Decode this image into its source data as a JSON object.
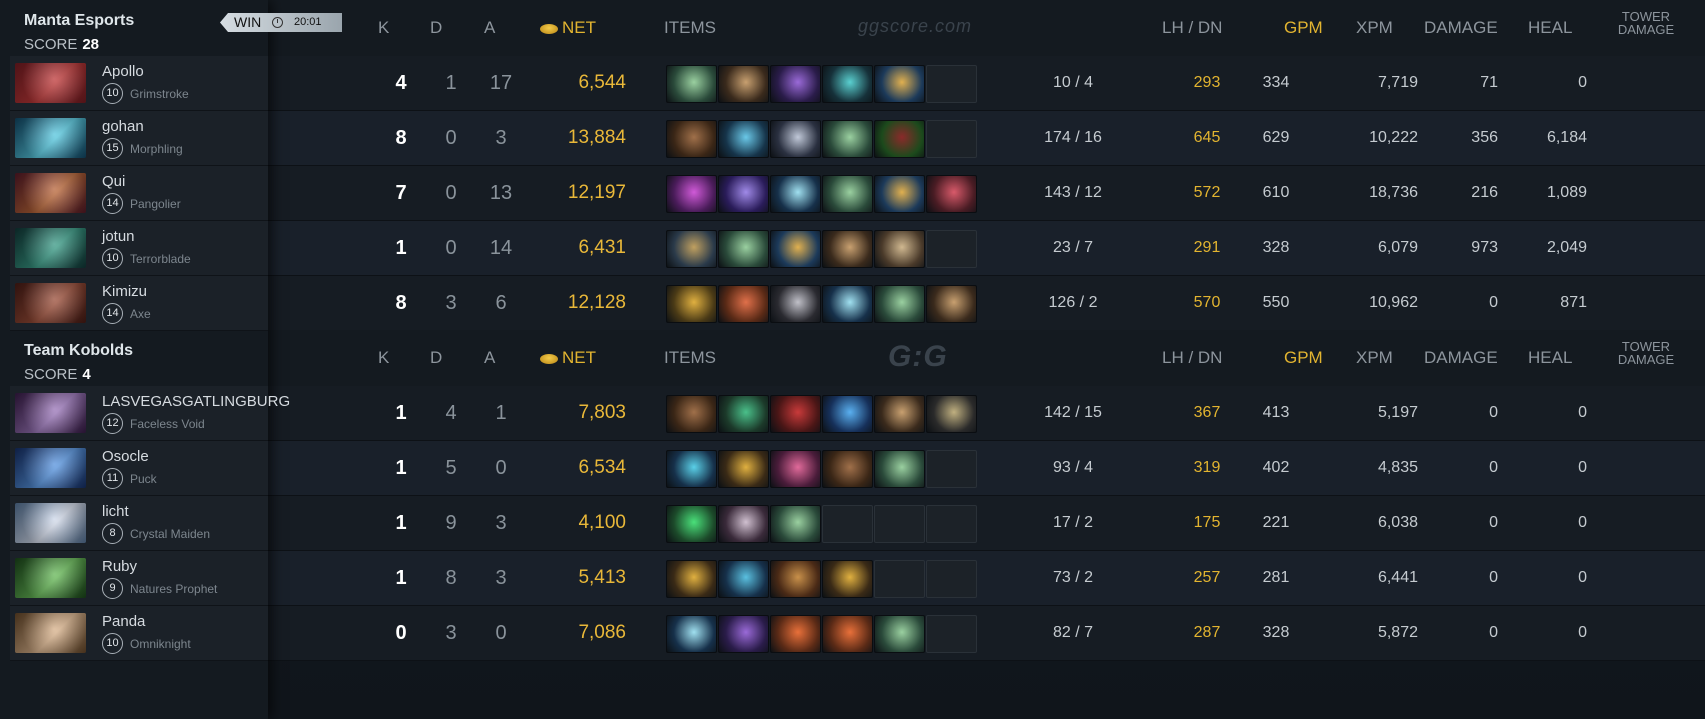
{
  "headers": {
    "k": "K",
    "d": "D",
    "a": "A",
    "net": "NET",
    "items": "ITEMS",
    "lhdn": "LH  /  DN",
    "gpm": "GPM",
    "xpm": "XPM",
    "damage": "DAMAGE",
    "heal": "HEAL",
    "tower_line1": "TOWER",
    "tower_line2": "DAMAGE"
  },
  "watermark_top": "ggscore.com",
  "watermark_mid": "G:G",
  "teams": [
    {
      "name": "Manta Esports",
      "score_label": "SCORE",
      "score": "28",
      "result": "WIN",
      "time": "20:01",
      "players": [
        {
          "name": "Apollo",
          "level": "10",
          "hero": "Grimstroke",
          "k": "4",
          "d": "1",
          "a": "17",
          "net": "6,544",
          "lhdn": "10  /  4",
          "gpm": "293",
          "xpm": "334",
          "damage": "7,719",
          "heal": "71",
          "tower": "0",
          "portrait": [
            "#7a1d24",
            "#c43a3a"
          ],
          "items": [
            [
              "#2a4a3a",
              "#9ad0a0"
            ],
            [
              "#3a2a1c",
              "#c8a070"
            ],
            [
              "#2a1c4a",
              "#9a6ad8"
            ],
            [
              "#16313a",
              "#5ad0d0"
            ],
            [
              "#1c3a5a",
              "#e0b050"
            ],
            null
          ]
        },
        {
          "name": "gohan",
          "level": "15",
          "hero": "Morphling",
          "k": "8",
          "d": "0",
          "a": "3",
          "net": "13,884",
          "lhdn": "174  /  16",
          "gpm": "645",
          "xpm": "629",
          "damage": "10,222",
          "heal": "356",
          "tower": "6,184",
          "portrait": [
            "#124a6a",
            "#5ad0e8"
          ],
          "items": [
            [
              "#3a2616",
              "#a0704a"
            ],
            [
              "#16344a",
              "#6ac8e8"
            ],
            [
              "#2a3040",
              "#c0c8d8"
            ],
            [
              "#2a4a3a",
              "#9ad0a0"
            ],
            [
              "#1c4a1c",
              "#8a2a2a"
            ],
            null
          ]
        },
        {
          "name": "Qui",
          "level": "14",
          "hero": "Pangolier",
          "k": "7",
          "d": "0",
          "a": "13",
          "net": "12,197",
          "lhdn": "143  /  12",
          "gpm": "572",
          "xpm": "610",
          "damage": "18,736",
          "heal": "216",
          "tower": "1,089",
          "portrait": [
            "#5a1a2a",
            "#c06a3a"
          ],
          "items": [
            [
              "#4a1c5a",
              "#d05ad8"
            ],
            [
              "#2a1c5a",
              "#a08ae8"
            ],
            [
              "#16304a",
              "#a0e0f0"
            ],
            [
              "#2a4a3a",
              "#9ad0a0"
            ],
            [
              "#1c3a5a",
              "#e0b050"
            ],
            [
              "#4a1c24",
              "#d85a6a"
            ]
          ]
        },
        {
          "name": "jotun",
          "level": "10",
          "hero": "Terrorblade",
          "k": "1",
          "d": "0",
          "a": "14",
          "net": "6,431",
          "lhdn": "23  /  7",
          "gpm": "291",
          "xpm": "328",
          "damage": "6,079",
          "heal": "973",
          "tower": "2,049",
          "portrait": [
            "#123a3a",
            "#3aa08a"
          ],
          "items": [
            [
              "#2a3a4a",
              "#c0a060"
            ],
            [
              "#2a4a3a",
              "#9ad0a0"
            ],
            [
              "#1c3a5a",
              "#e0b050"
            ],
            [
              "#3a2a1c",
              "#c8a070"
            ],
            [
              "#4a3a2a",
              "#d0b890"
            ],
            null
          ]
        },
        {
          "name": "Kimizu",
          "level": "14",
          "hero": "Axe",
          "k": "8",
          "d": "3",
          "a": "6",
          "net": "12,128",
          "lhdn": "126  /  2",
          "gpm": "570",
          "xpm": "550",
          "damage": "10,962",
          "heal": "0",
          "tower": "871",
          "portrait": [
            "#4a1c16",
            "#a0503a"
          ],
          "items": [
            [
              "#4a3a16",
              "#e0b040"
            ],
            [
              "#5a2a16",
              "#e0704a"
            ],
            [
              "#2a2a30",
              "#c0c0c8"
            ],
            [
              "#16304a",
              "#a0e0f0"
            ],
            [
              "#2a4a3a",
              "#9ad0a0"
            ],
            [
              "#3a2a1c",
              "#c8a070"
            ]
          ]
        }
      ]
    },
    {
      "name": "Team Kobolds",
      "score_label": "SCORE",
      "score": "4",
      "players": [
        {
          "name": "LASVEGASGATLINGBURG",
          "level": "12",
          "hero": "Faceless Void",
          "k": "1",
          "d": "4",
          "a": "1",
          "net": "7,803",
          "lhdn": "142  /  15",
          "gpm": "367",
          "xpm": "413",
          "damage": "5,197",
          "heal": "0",
          "tower": "0",
          "portrait": [
            "#3a1c4a",
            "#a07ac0"
          ],
          "items": [
            [
              "#3a2616",
              "#a0704a"
            ],
            [
              "#1c3a2a",
              "#4ac08a"
            ],
            [
              "#4a1616",
              "#c83a3a"
            ],
            [
              "#16305a",
              "#5ab0f0"
            ],
            [
              "#3a2a1c",
              "#c8a070"
            ],
            [
              "#2a2a2a",
              "#c0b080"
            ]
          ]
        },
        {
          "name": "Osocle",
          "level": "11",
          "hero": "Puck",
          "k": "1",
          "d": "5",
          "a": "0",
          "net": "6,534",
          "lhdn": "93  /  4",
          "gpm": "319",
          "xpm": "402",
          "damage": "4,835",
          "heal": "0",
          "tower": "0",
          "portrait": [
            "#16306a",
            "#5a9ae8"
          ],
          "items": [
            [
              "#16304a",
              "#5ad0e8"
            ],
            [
              "#3a2a16",
              "#e0b040"
            ],
            [
              "#4a1c3a",
              "#e06a9a"
            ],
            [
              "#3a2616",
              "#a0704a"
            ],
            [
              "#2a4a3a",
              "#9ad0a0"
            ],
            null
          ]
        },
        {
          "name": "licht",
          "level": "8",
          "hero": "Crystal Maiden",
          "k": "1",
          "d": "9",
          "a": "3",
          "net": "4,100",
          "lhdn": "17  /  2",
          "gpm": "175",
          "xpm": "221",
          "damage": "6,038",
          "heal": "0",
          "tower": "0",
          "portrait": [
            "#5a7aa0",
            "#d8e0f0"
          ],
          "items": [
            [
              "#1c4a2a",
              "#4ae07a"
            ],
            [
              "#3a2a3a",
              "#d0c0d0"
            ],
            [
              "#2a4a3a",
              "#9ad0a0"
            ],
            null,
            null,
            null
          ]
        },
        {
          "name": "Ruby",
          "level": "9",
          "hero": "Natures Prophet",
          "k": "1",
          "d": "8",
          "a": "3",
          "net": "5,413",
          "lhdn": "73  /  2",
          "gpm": "257",
          "xpm": "281",
          "damage": "6,441",
          "heal": "0",
          "tower": "0",
          "portrait": [
            "#1c4a1c",
            "#6ac05a"
          ],
          "items": [
            [
              "#3a2a16",
              "#e0b040"
            ],
            [
              "#16304a",
              "#5ac0e0"
            ],
            [
              "#4a2a16",
              "#c8904a"
            ],
            [
              "#3a2a16",
              "#e0b040"
            ],
            null,
            null
          ]
        },
        {
          "name": "Panda",
          "level": "10",
          "hero": "Omniknight",
          "k": "0",
          "d": "3",
          "a": "0",
          "net": "7,086",
          "lhdn": "82  /  7",
          "gpm": "287",
          "xpm": "328",
          "damage": "5,872",
          "heal": "0",
          "tower": "0",
          "portrait": [
            "#6a4a2a",
            "#e0b890"
          ],
          "items": [
            [
              "#16304a",
              "#a0e0f0"
            ],
            [
              "#2a1c4a",
              "#9a6ad8"
            ],
            [
              "#5a2a16",
              "#e8703a"
            ],
            [
              "#5a2a16",
              "#e8703a"
            ],
            [
              "#2a4a3a",
              "#9ad0a0"
            ],
            null
          ]
        }
      ]
    }
  ]
}
